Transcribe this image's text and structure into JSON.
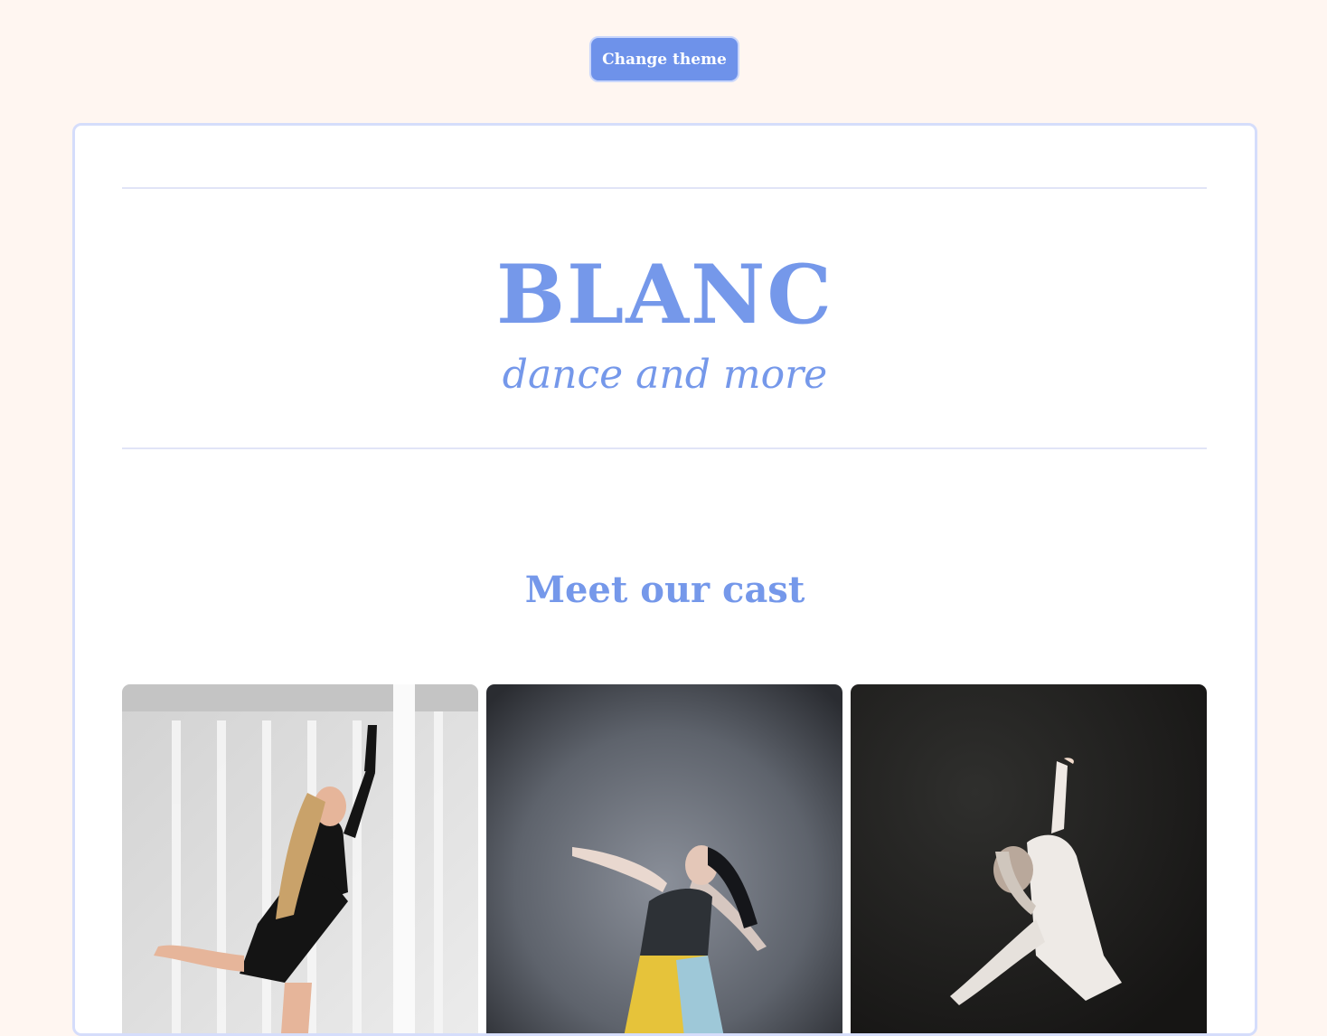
{
  "toolbar": {
    "change_theme_label": "Change theme"
  },
  "hero": {
    "brand": "BLANC",
    "tagline": "dance and more"
  },
  "cast_section": {
    "title": "Meet our cast",
    "photos": [
      {
        "subject": "dancer-white-studio"
      },
      {
        "subject": "dancer-grey-backdrop"
      },
      {
        "subject": "dancer-dark-stage"
      }
    ]
  },
  "colors": {
    "page_background": "#fff6f1",
    "accent": "#7598ea",
    "button": "#6e92ea",
    "card_border": "#d5ddfb"
  }
}
